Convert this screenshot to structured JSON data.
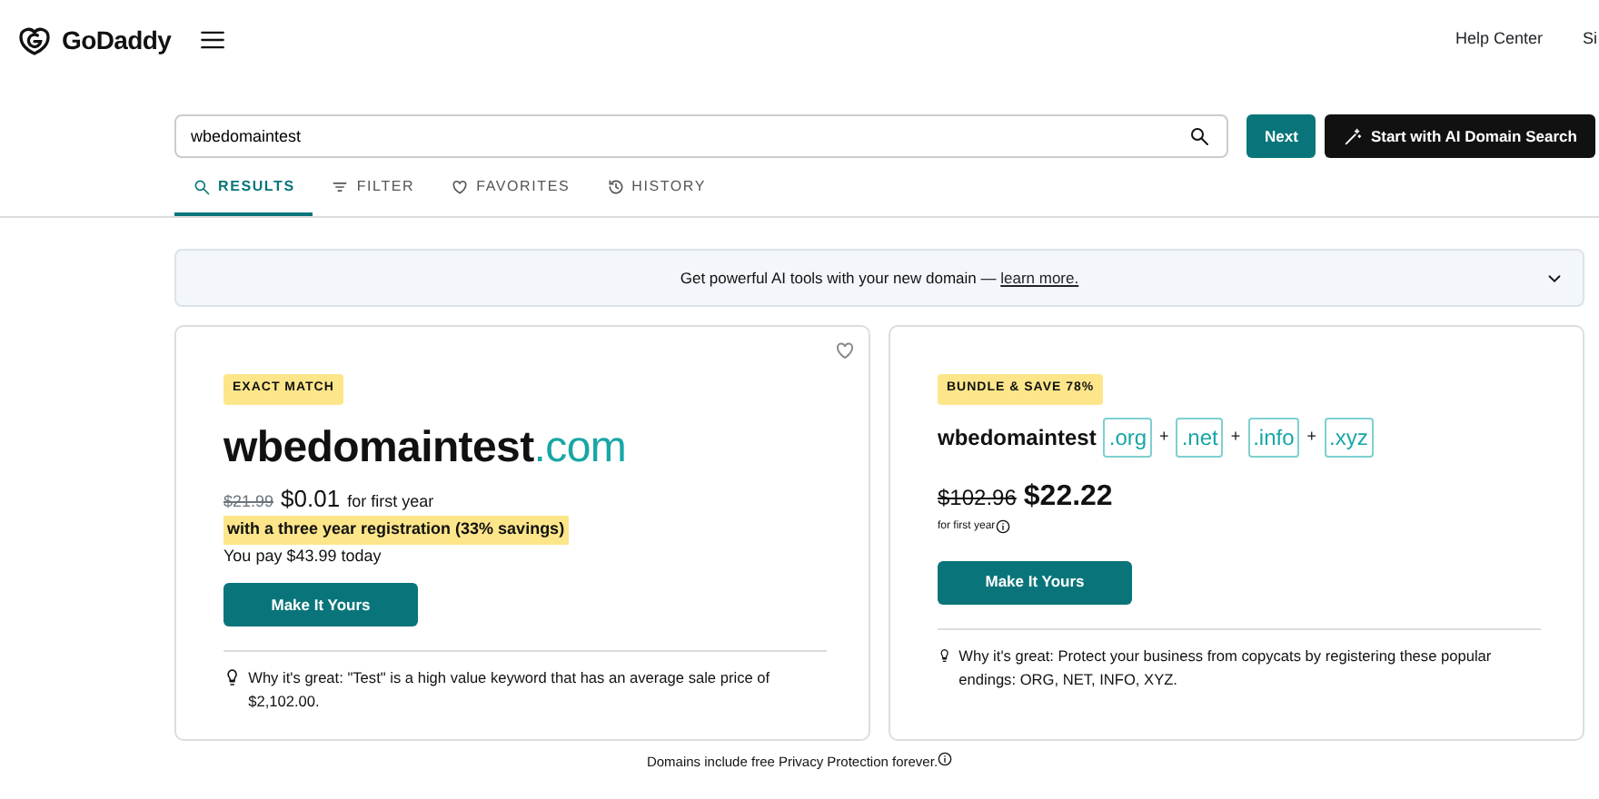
{
  "header": {
    "brand": "GoDaddy",
    "links": [
      "Help Center",
      "Si"
    ]
  },
  "search": {
    "value": "wbedomaintest",
    "buttons": [
      {
        "kind": "primary",
        "label": "Next"
      },
      {
        "kind": "ai",
        "label": "Start with AI Domain Search"
      }
    ]
  },
  "tabs": [
    {
      "label": "RESULTS",
      "kind": "search",
      "selected": true
    },
    {
      "label": "FILTER",
      "kind": "filter",
      "selected": false
    },
    {
      "label": "FAVORITES",
      "kind": "favorites",
      "selected": false
    },
    {
      "label": "HISTORY",
      "kind": "history",
      "selected": false
    }
  ],
  "banner": {
    "text": "Get powerful AI tools with your new domain —",
    "link": "learn more.",
    "expanded": false
  },
  "exact_match": {
    "badge": "EXACT MATCH",
    "name": "wbedomaintest",
    "tld": ".com",
    "old_price": "$21.99",
    "price": "$0.01",
    "price_note": "for first year",
    "offer": "with a three year registration (33% savings)",
    "pay_note": "You pay $43.99 today",
    "button": "Make It Yours",
    "why": "Why it's great: \"Test\" is a high value keyword that has an average sale price of $2,102.00.",
    "favorite": false
  },
  "bundle": {
    "badge": "BUNDLE & SAVE 78%",
    "name": "wbedomaintest",
    "tlds": [
      ".org",
      ".net",
      ".info",
      ".xyz"
    ],
    "joiner": "+",
    "old_price": "$102.96",
    "price": "$22.22",
    "price_note": "for first year",
    "button": "Make It Yours",
    "why": "Why it's great: Protect your business from copycats by registering these popular endings: ORG, NET, INFO, XYZ."
  },
  "footer_note": "Domains include free Privacy Protection forever."
}
